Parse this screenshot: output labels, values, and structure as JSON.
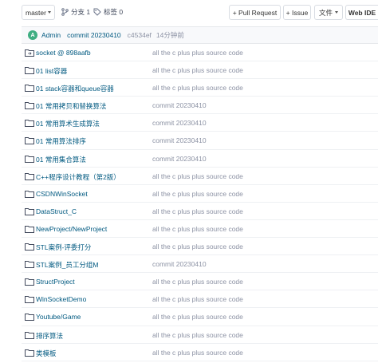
{
  "toolbar": {
    "branch": "master",
    "branches_label": "分支 1",
    "tags_label": "标签 0",
    "pull_request_label": "+ Pull Request",
    "issue_label": "+ Issue",
    "file_menu_label": "文件",
    "web_ide_label": "Web IDE"
  },
  "commit": {
    "avatar_letter": "A",
    "author": "Admin",
    "message": "commit 20230410",
    "hash": "c4534ef",
    "time": "14分钟前"
  },
  "files": [
    {
      "name": "socket @ 898aafb",
      "icon": "submodule-icon",
      "message": "all the c plus plus source code"
    },
    {
      "name": "01 list容器",
      "icon": "folder-icon",
      "message": "all the c plus plus source code"
    },
    {
      "name": "01 stack容器和queue容器",
      "icon": "folder-icon",
      "message": "all the c plus plus source code"
    },
    {
      "name": "01 常用拷贝和替换算法",
      "icon": "folder-icon",
      "message": "commit 20230410"
    },
    {
      "name": "01 常用算术生成算法",
      "icon": "folder-icon",
      "message": "commit 20230410"
    },
    {
      "name": "01 常用算法排序",
      "icon": "folder-icon",
      "message": "commit 20230410"
    },
    {
      "name": "01 常用集合算法",
      "icon": "folder-icon",
      "message": "commit 20230410"
    },
    {
      "name": "C++程序设计教程（第2版）",
      "icon": "folder-icon",
      "message": "all the c plus plus source code"
    },
    {
      "name": "CSDNWinSocket",
      "icon": "folder-icon",
      "message": "all the c plus plus source code"
    },
    {
      "name": "DataStruct_C",
      "icon": "folder-icon",
      "message": "all the c plus plus source code"
    },
    {
      "name": "NewProject/NewProject",
      "icon": "folder-icon",
      "message": "all the c plus plus source code"
    },
    {
      "name": "STL案例-评委打分",
      "icon": "folder-icon",
      "message": "all the c plus plus source code"
    },
    {
      "name": "STL案例_员工分组M",
      "icon": "folder-icon",
      "message": "commit 20230410"
    },
    {
      "name": "StructProject",
      "icon": "folder-icon",
      "message": "all the c plus plus source code"
    },
    {
      "name": "WinSocketDemo",
      "icon": "folder-icon",
      "message": "all the c plus plus source code"
    },
    {
      "name": "Youtube/Game",
      "icon": "folder-icon",
      "message": "all the c plus plus source code"
    },
    {
      "name": "排序算法",
      "icon": "folder-icon",
      "message": "all the c plus plus source code"
    },
    {
      "name": "类模板",
      "icon": "folder-icon",
      "message": "all the c plus plus source code"
    }
  ]
}
